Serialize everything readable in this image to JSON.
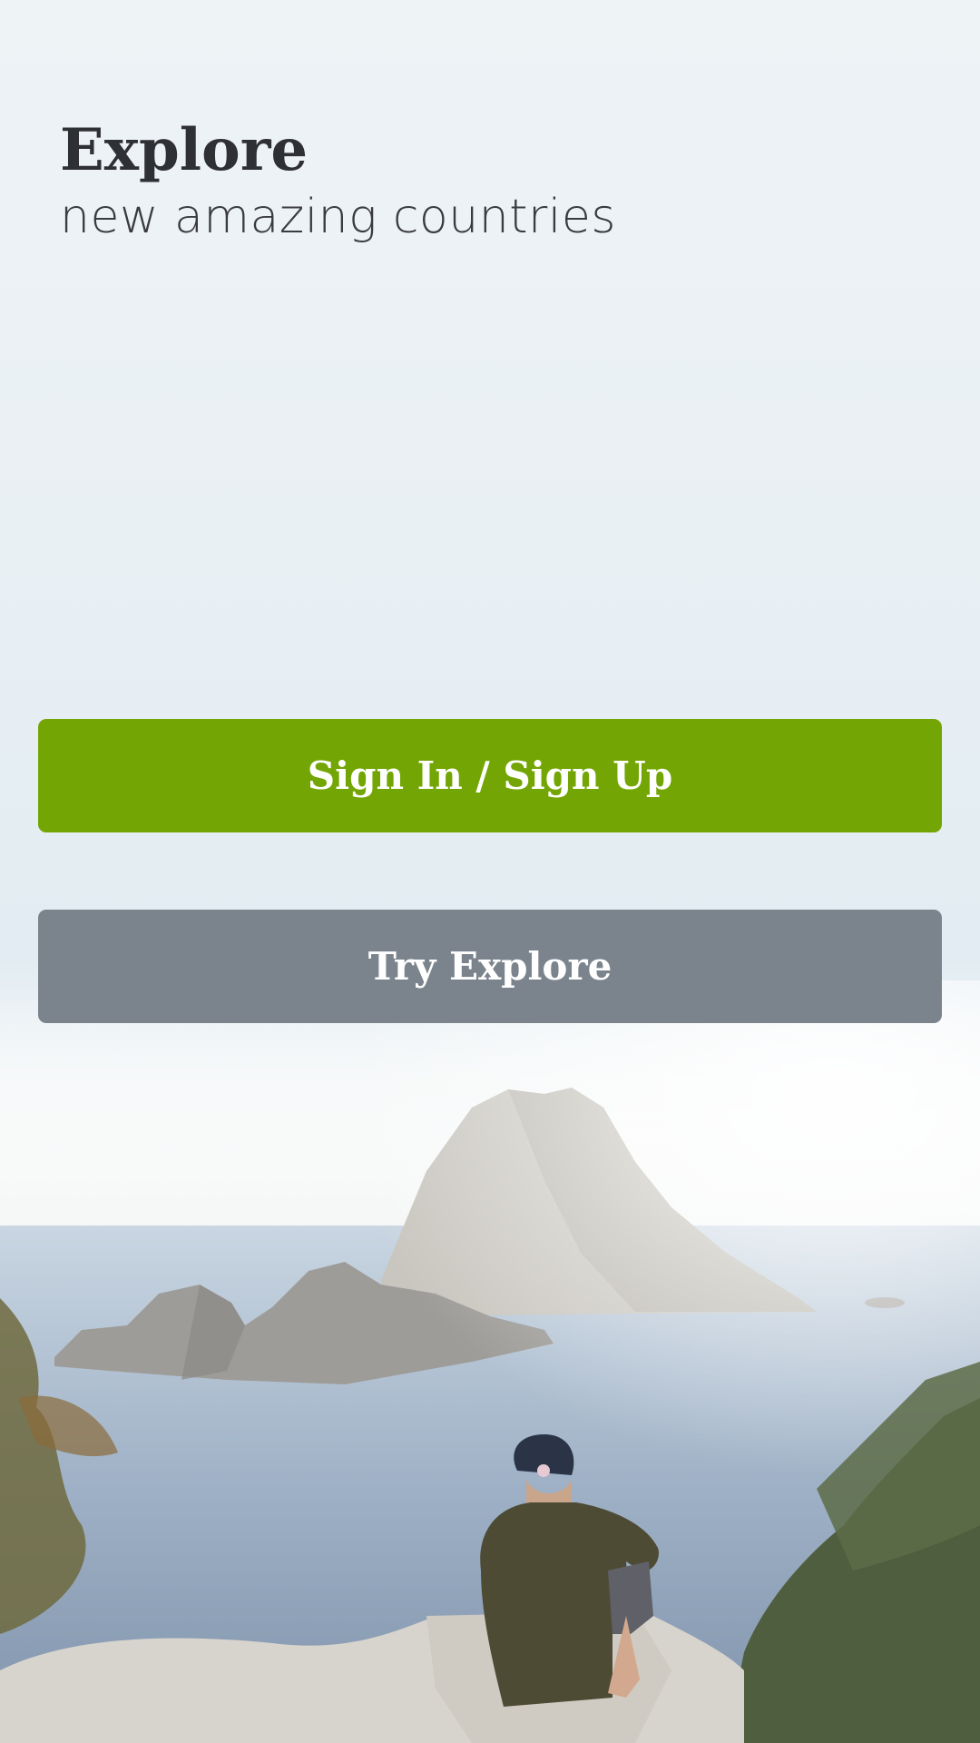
{
  "header": {
    "title": "Explore",
    "subtitle": "new amazing countries"
  },
  "actions": {
    "primary_label": "Sign In / Sign Up",
    "secondary_label": "Try Explore"
  },
  "colors": {
    "primary_button": "#73a605",
    "secondary_button": "#7b848d",
    "title_text": "#2f3033"
  }
}
